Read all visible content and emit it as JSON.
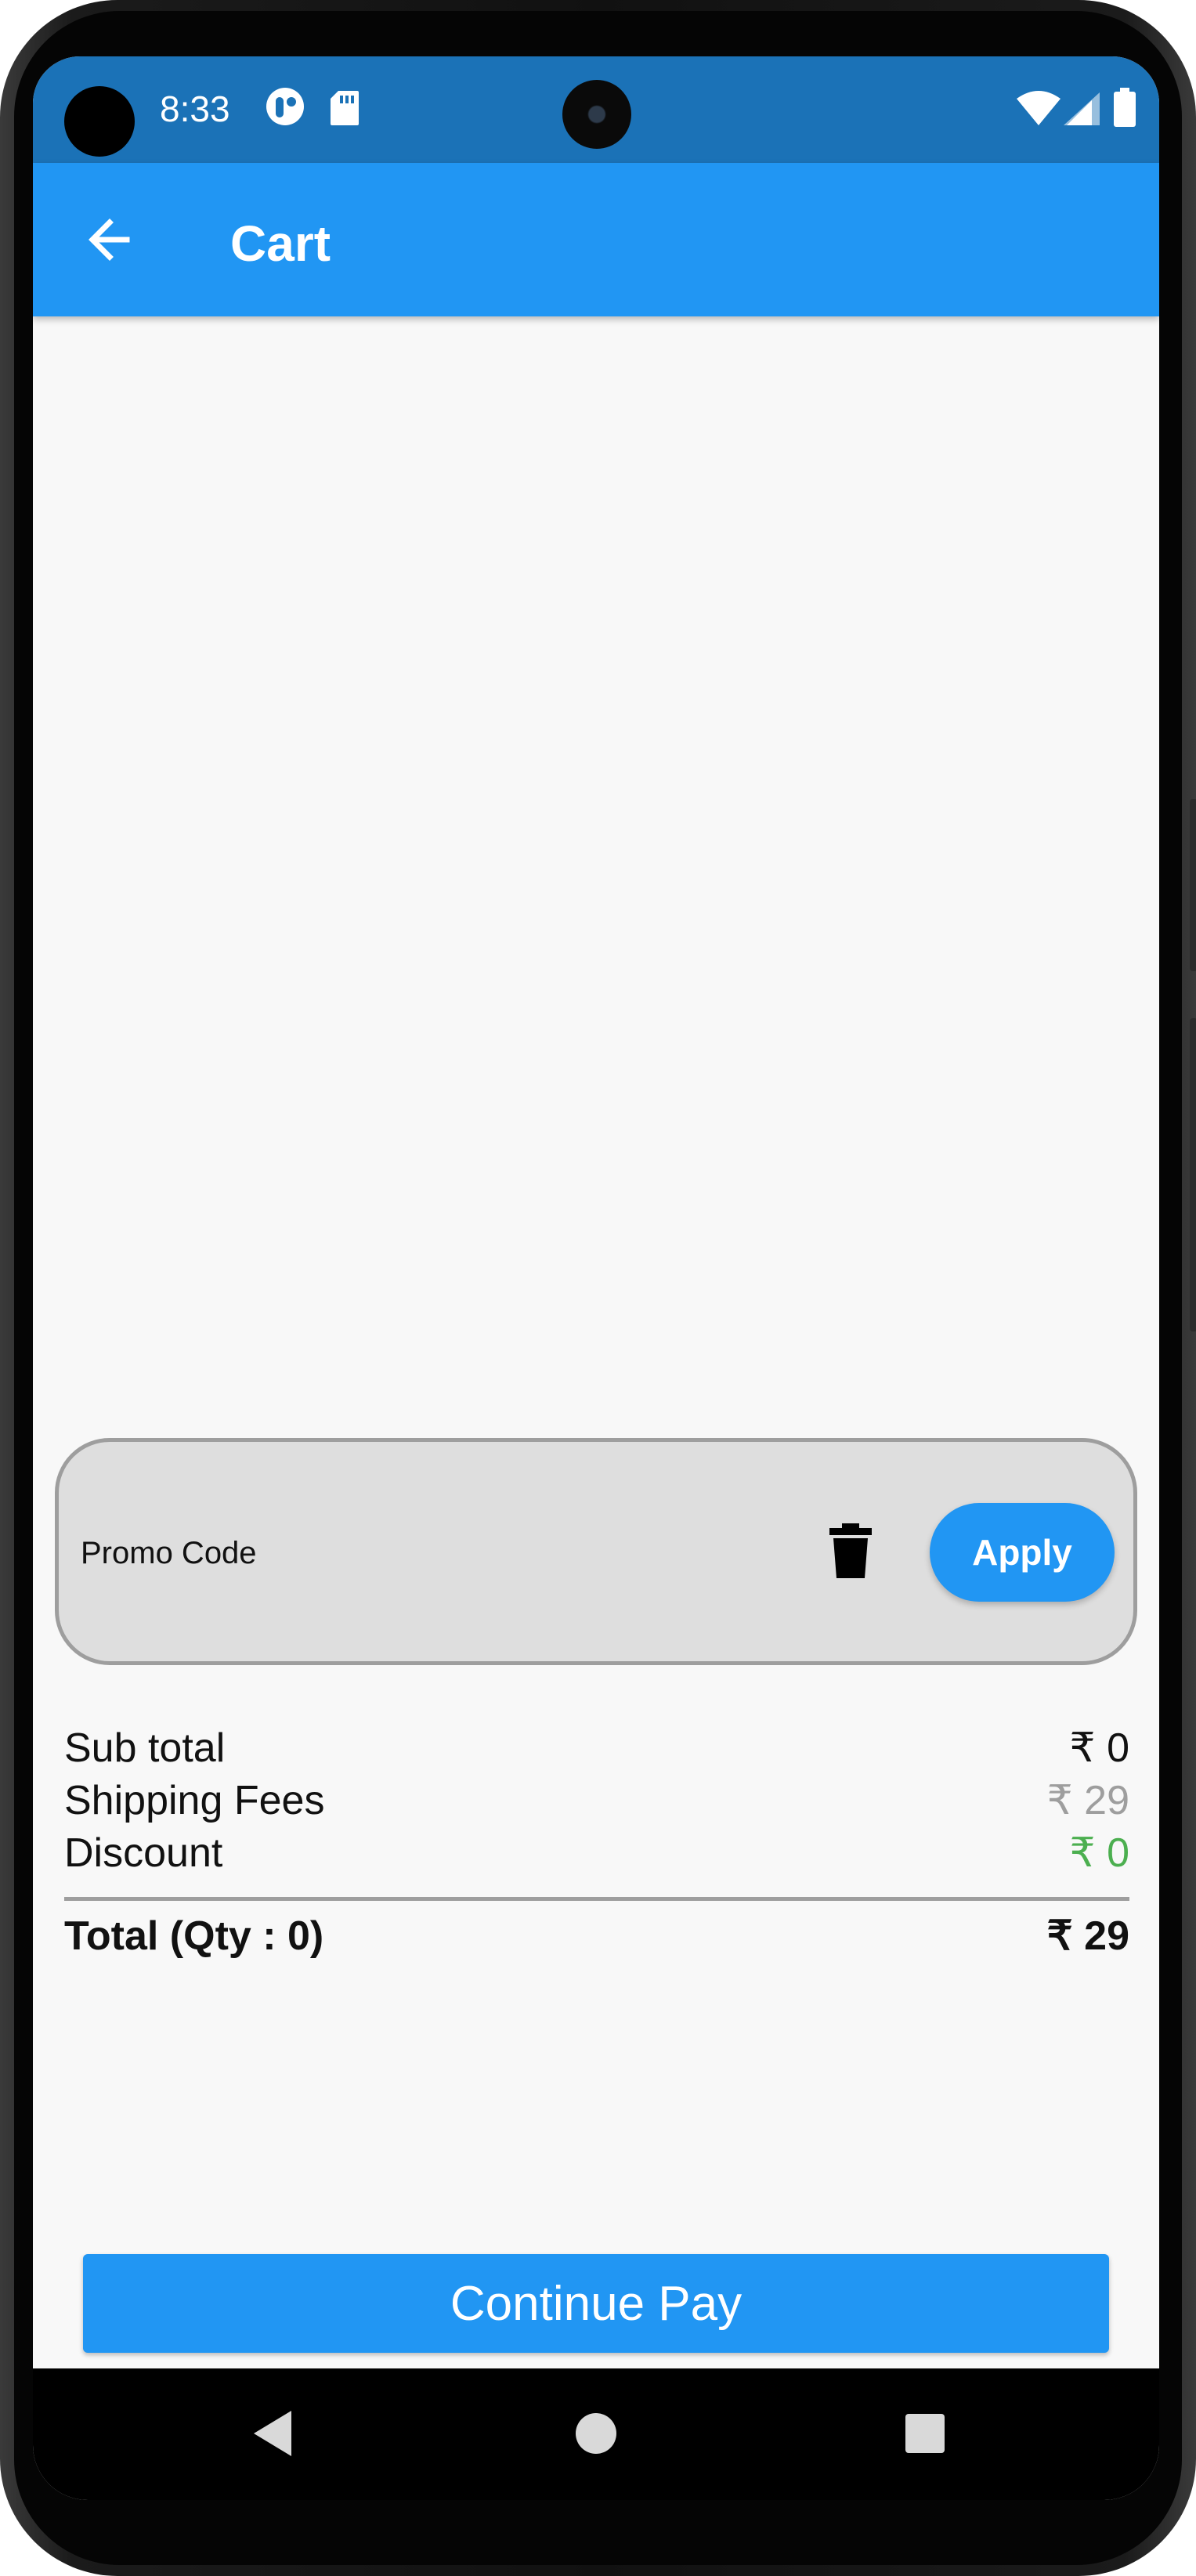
{
  "status_bar": {
    "time": "8:33",
    "icons": [
      "notification-app-icon",
      "sd-card-icon",
      "wifi-icon",
      "signal-icon",
      "battery-icon"
    ]
  },
  "app_bar": {
    "title": "Cart",
    "back_icon": "arrow-left-icon"
  },
  "promo": {
    "placeholder": "Promo Code",
    "value": "",
    "clear_icon": "trash-icon",
    "apply_label": "Apply"
  },
  "summary": {
    "subtotal_label": "Sub total",
    "subtotal_value": "₹ 0",
    "shipping_label": "Shipping Fees",
    "shipping_value": "₹ 29",
    "discount_label": "Discount",
    "discount_value": "₹ 0",
    "total_label": "Total (Qty : 0)",
    "total_value": "₹ 29"
  },
  "actions": {
    "continue_label": "Continue Pay"
  },
  "nav": {
    "back_icon": "nav-back-icon",
    "home_icon": "nav-home-icon",
    "recents_icon": "nav-recents-icon"
  },
  "colors": {
    "primary": "#2196f3",
    "status_bar": "#1b72b7",
    "shipping": "#9e9e9e",
    "discount": "#4caf50"
  }
}
